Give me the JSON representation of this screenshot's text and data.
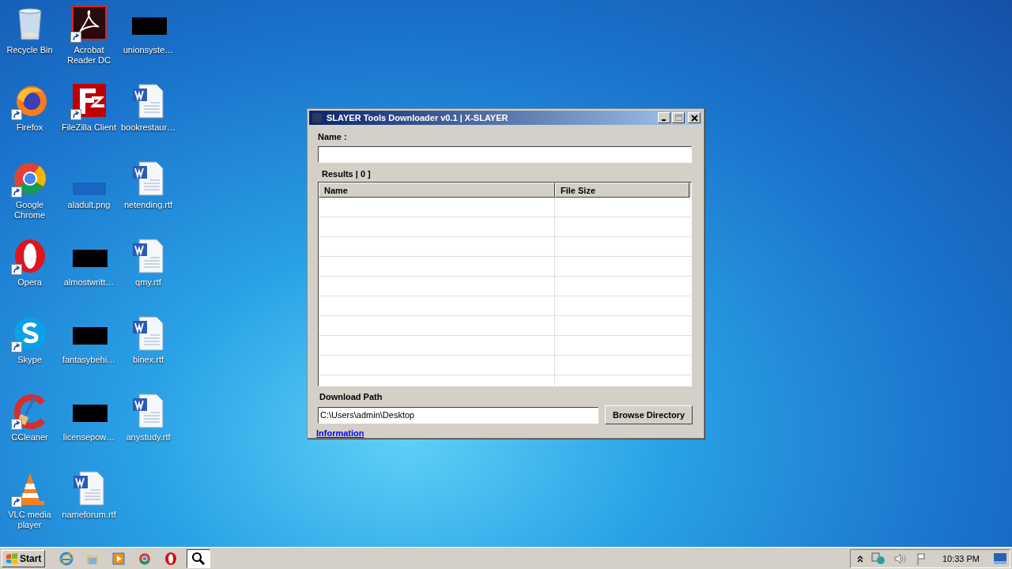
{
  "desktop_icons": [
    {
      "label": "Recycle Bin",
      "kind": "recycle",
      "shortcut": false
    },
    {
      "label": "Acrobat Reader DC",
      "kind": "acrobat",
      "shortcut": true
    },
    {
      "label": "unionsyste…",
      "kind": "blackbox",
      "shortcut": false
    },
    {
      "label": "Firefox",
      "kind": "firefox",
      "shortcut": true
    },
    {
      "label": "FileZilla Client",
      "kind": "filezilla",
      "shortcut": true
    },
    {
      "label": "bookrestaur…",
      "kind": "word",
      "shortcut": false
    },
    {
      "label": "Google Chrome",
      "kind": "chrome",
      "shortcut": true
    },
    {
      "label": "aladult.png",
      "kind": "blank",
      "shortcut": false
    },
    {
      "label": "netending.rtf",
      "kind": "word",
      "shortcut": false
    },
    {
      "label": "Opera",
      "kind": "opera",
      "shortcut": true
    },
    {
      "label": "almostwritt…",
      "kind": "blackbox",
      "shortcut": false
    },
    {
      "label": "qmy.rtf",
      "kind": "word",
      "shortcut": false
    },
    {
      "label": "Skype",
      "kind": "skype",
      "shortcut": true
    },
    {
      "label": "fantasybehi…",
      "kind": "blackbox",
      "shortcut": false
    },
    {
      "label": "binex.rtf",
      "kind": "word",
      "shortcut": false
    },
    {
      "label": "CCleaner",
      "kind": "ccleaner",
      "shortcut": true
    },
    {
      "label": "licensepow…",
      "kind": "blackbox",
      "shortcut": false
    },
    {
      "label": "anystudy.rtf",
      "kind": "word",
      "shortcut": false
    },
    {
      "label": "VLC media player",
      "kind": "vlc",
      "shortcut": true
    },
    {
      "label": "nameforum.rtf",
      "kind": "word",
      "shortcut": false
    }
  ],
  "window": {
    "title": "SLAYER Tools Downloader v0.1 | X-SLAYER",
    "name_label": "Name :",
    "results_label": "Results | 0 ]",
    "columns": [
      "Name",
      "File Size"
    ],
    "download_path_label": "Download Path",
    "download_path": "C:\\Users\\admin\\Desktop",
    "browse_button": "Browse Directory",
    "info_link": "Information"
  },
  "taskbar": {
    "start_label": "Start",
    "apps": [
      {
        "kind": "ie",
        "selected": false
      },
      {
        "kind": "folder",
        "selected": false
      },
      {
        "kind": "media",
        "selected": false
      },
      {
        "kind": "chrome",
        "selected": false
      },
      {
        "kind": "opera",
        "selected": false
      },
      {
        "kind": "search",
        "selected": true
      }
    ],
    "time": "10:33 PM"
  }
}
